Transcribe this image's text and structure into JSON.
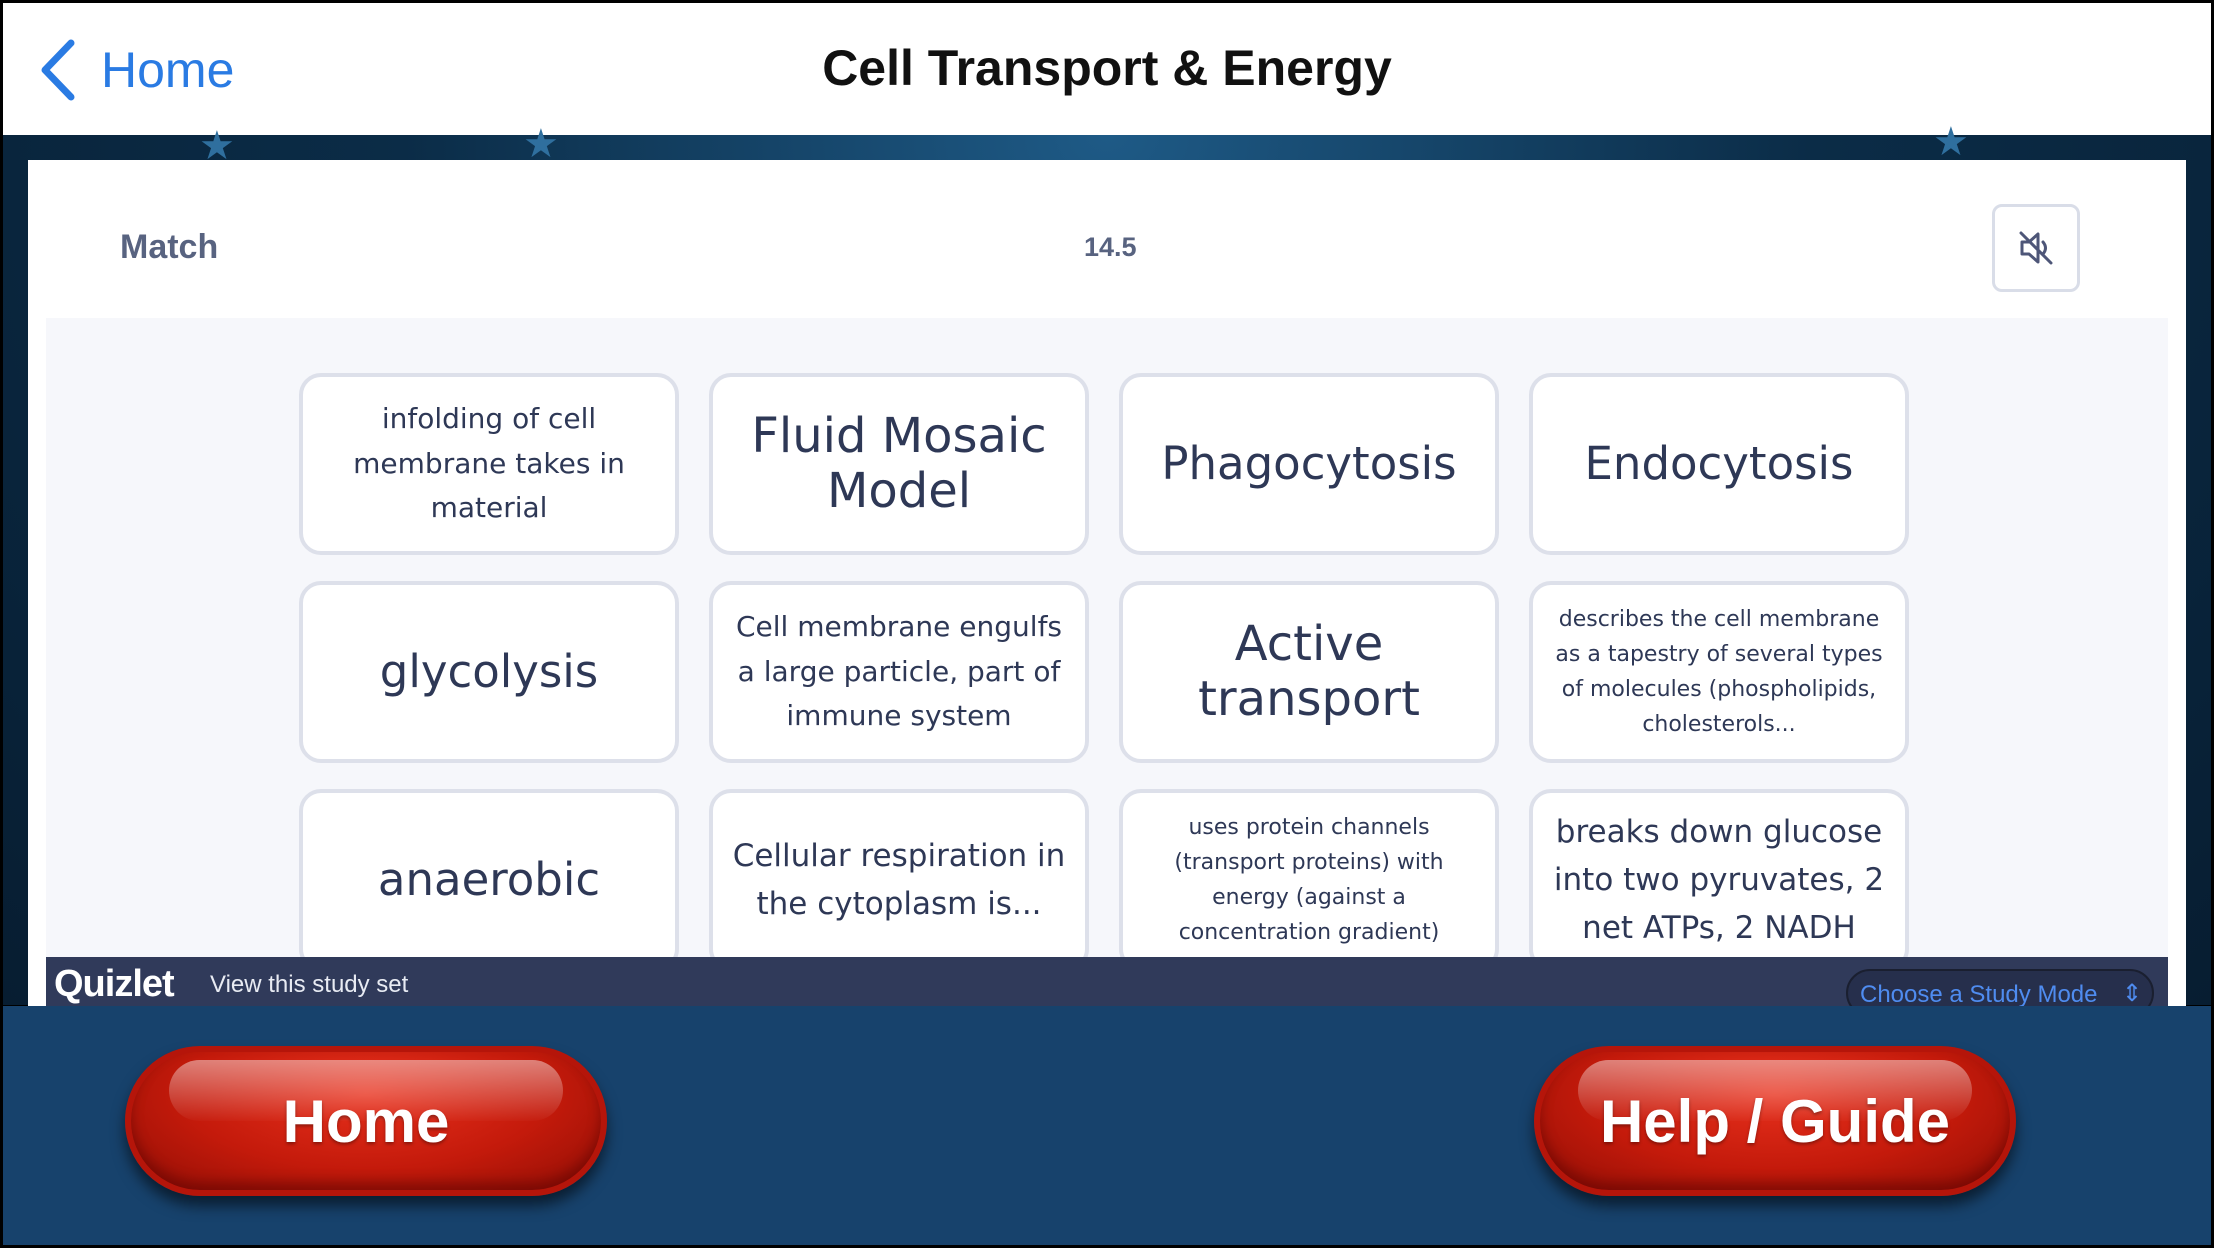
{
  "nav": {
    "back_label": "Home",
    "title": "Cell Transport & Energy"
  },
  "match": {
    "title": "Match",
    "timer": "14.5",
    "sound_icon": "sound-muted-icon"
  },
  "cards": [
    {
      "text": "infolding of cell membrane takes in material"
    },
    {
      "text": "Fluid Mosaic Model"
    },
    {
      "text": "Phagocytosis"
    },
    {
      "text": "Endocytosis"
    },
    {
      "text": "glycolysis"
    },
    {
      "text": "Cell membrane engulfs a large particle, part of immune system"
    },
    {
      "text": "Active transport"
    },
    {
      "text": "describes the cell membrane as a tapestry of several types of molecules (phospholipids, cholesterols..."
    },
    {
      "text": "anaerobic"
    },
    {
      "text": "Cellular respiration in the cytoplasm is..."
    },
    {
      "text": "uses protein channels (transport proteins) with energy (against a concentration gradient)"
    },
    {
      "text": "breaks down glucose into two pyruvates, 2 net ATPs, 2 NADH"
    }
  ],
  "footer": {
    "logo": "Quizlet",
    "view_set": "View this study set",
    "study_mode": "Choose a Study Mode"
  },
  "bottom": {
    "home_label": "Home",
    "help_label": "Help / Guide"
  },
  "colors": {
    "nav_link": "#2a7be3",
    "bottom_bar": "#17426c",
    "pill_red": "#c41a0b",
    "quizlet_bar": "#303a5a"
  }
}
